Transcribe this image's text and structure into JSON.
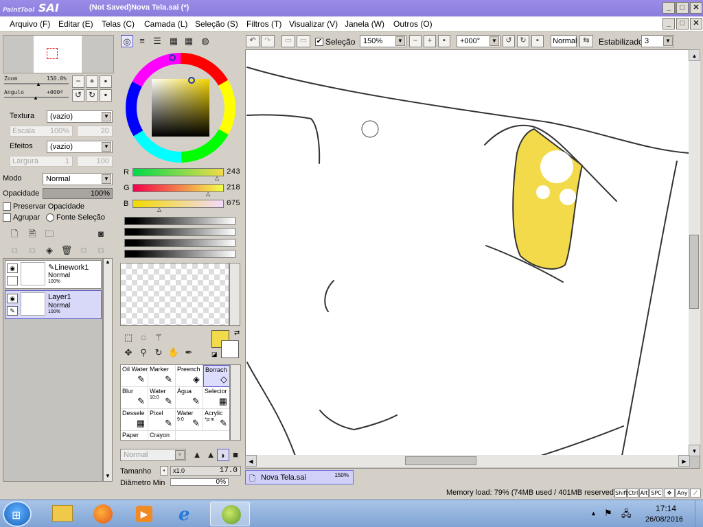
{
  "window": {
    "logo_small": "PaintTool",
    "logo_big": "SAI",
    "title": "(Not Saved)Nova Tela.sai (*)",
    "minimize": "_",
    "maximize": "□",
    "close": "✕"
  },
  "menu": [
    {
      "label": "Arquivo (F)"
    },
    {
      "label": "Editar (E)"
    },
    {
      "label": "Telas (C)"
    },
    {
      "label": "Camada (L)"
    },
    {
      "label": "Seleção (S)"
    },
    {
      "label": "Filtros (T)"
    },
    {
      "label": "Visualizar (V)"
    },
    {
      "label": "Janela (W)"
    },
    {
      "label": "Outros (O)"
    }
  ],
  "navigator": {
    "zoom_label": "Zoom",
    "zoom_value": "150.0%",
    "angle_label": "Angulo",
    "angle_value": "+000ª"
  },
  "texture": {
    "label": "Textura",
    "value": "(vazio)",
    "scale_label": "Escala",
    "scale_value": "100%",
    "scale_num": "20"
  },
  "effects": {
    "label": "Efeitos",
    "value": "(vazio)",
    "width_label": "Largura",
    "width_value": "1",
    "width_num": "100"
  },
  "blend": {
    "mode_label": "Modo",
    "mode_value": "Normal",
    "opacity_label": "Opacidade",
    "opacity_value": "100%",
    "preserve_opacity": "Preservar Opacidade",
    "group": "Agrupar",
    "selection_source": "Fonte Seleção"
  },
  "layers": [
    {
      "name": "Linework1",
      "mode": "Normal",
      "opacity": "100%",
      "selected": false
    },
    {
      "name": "Layer1",
      "mode": "Normal",
      "opacity": "100%",
      "selected": true
    }
  ],
  "color": {
    "r_label": "R",
    "r": "243",
    "g_label": "G",
    "g": "218",
    "b_label": "B",
    "b": "075",
    "current": "#f3da4b"
  },
  "brushes": [
    {
      "name": "Oil Water",
      "icon": "✎"
    },
    {
      "name": "Marker",
      "icon": "✎"
    },
    {
      "name": "Preench",
      "icon": "◈"
    },
    {
      "name": "Borrach",
      "icon": "◇"
    },
    {
      "name": "Blur",
      "icon": "✎"
    },
    {
      "name": "Water",
      "sub": "10:0",
      "icon": "✎"
    },
    {
      "name": "Água",
      "icon": "✎"
    },
    {
      "name": "Selecior",
      "icon": "▦"
    },
    {
      "name": "Dessele",
      "icon": "▦"
    },
    {
      "name": "Pixel",
      "icon": "✎"
    },
    {
      "name": "Water",
      "sub": "9:0",
      "icon": "✎"
    },
    {
      "name": "Acrylic",
      "sub": "*p:m",
      "icon": "✎"
    },
    {
      "name": "Paper",
      "icon": ""
    },
    {
      "name": "Crayon",
      "icon": ""
    }
  ],
  "brush_settings": {
    "mode_value": "Normal",
    "size_label": "Tamanho",
    "size_mult": "x1.0",
    "size_value": "17.0",
    "min_diam_label": "Diâmetro Min",
    "min_diam_value": "0%"
  },
  "toolbar": {
    "selection_label": "Seleção",
    "zoom_value": "150%",
    "angle_value": "+000°",
    "mode_value": "Normal",
    "stabilizer_label": "Estabilizador",
    "stabilizer_value": "3"
  },
  "document_tab": {
    "name": "Nova Tela.sai",
    "zoom": "150%"
  },
  "status": {
    "memory": "Memory load: 79% (74MB used / 401MB reserved)",
    "keys": [
      "Shift",
      "Ctrl",
      "Alt",
      "SPC",
      "✥",
      "Any",
      "⟋"
    ]
  },
  "taskbar": {
    "time": "17:14",
    "date": "26/08/2016"
  }
}
